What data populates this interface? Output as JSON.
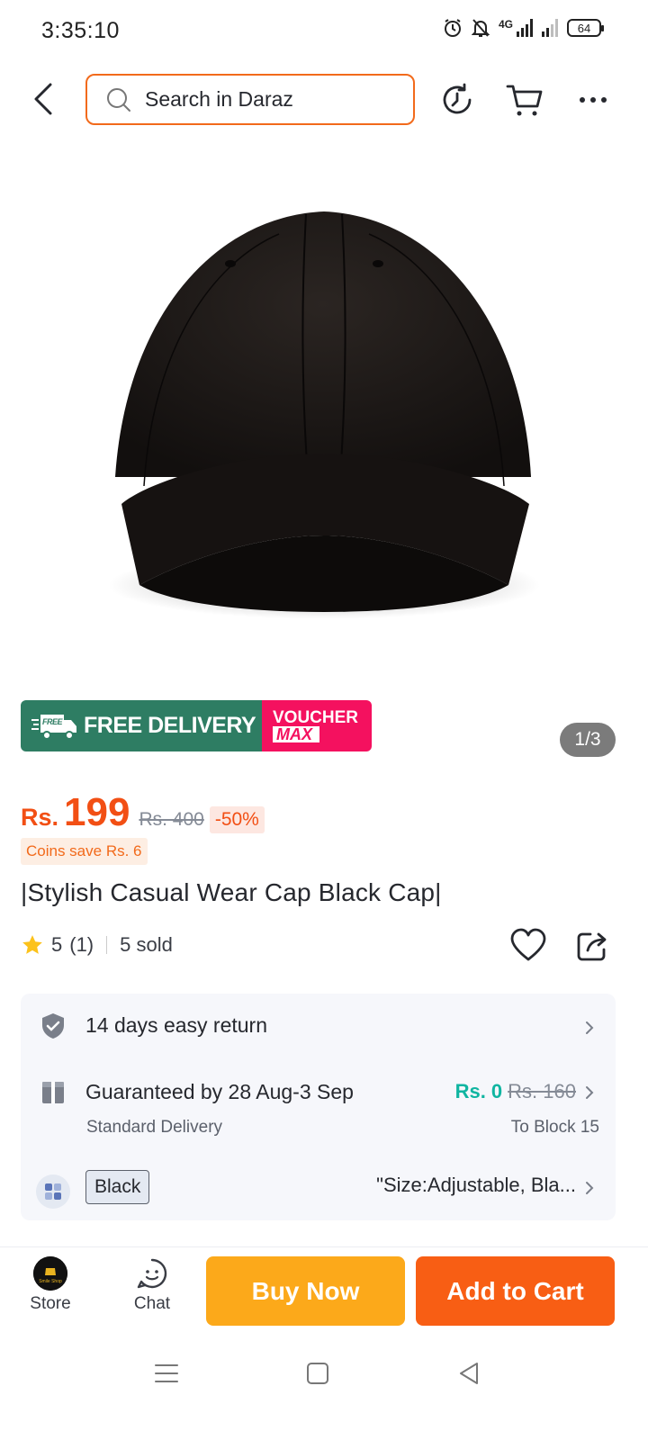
{
  "status_bar": {
    "time": "3:35:10",
    "network": "4G",
    "battery": "64"
  },
  "header": {
    "search_placeholder": "Search in Daraz"
  },
  "gallery": {
    "counter": "1/3",
    "promo_free": "FREE DELIVERY",
    "promo_free_tag": "FREE",
    "promo_voucher_1": "VOUCHER",
    "promo_voucher_2": "MAX"
  },
  "product": {
    "currency": "Rs.",
    "price": "199",
    "original_price": "Rs. 400",
    "discount": "-50%",
    "coins": "Coins save Rs. 6",
    "title": "|Stylish Casual Wear Cap Black Cap|",
    "rating": "5",
    "rating_count": "(1)",
    "sold": "5 sold"
  },
  "info": {
    "return_text": "14 days easy return",
    "delivery_text": "Guaranteed by 28 Aug-3 Sep",
    "delivery_sub": "Standard Delivery",
    "shipping_price": "Rs. 0",
    "shipping_old_price": "Rs. 160",
    "shipping_to": "To Block 15",
    "variant_selected": "Black",
    "variant_detail": "\"Size:Adjustable, Bla..."
  },
  "action_bar": {
    "store_label": "Store",
    "store_logo_text": "Smile Shop",
    "chat_label": "Chat",
    "buy_now": "Buy Now",
    "add_to_cart": "Add to Cart"
  },
  "colors": {
    "brand_orange": "#f85e14",
    "buy_yellow": "#fca91a",
    "free_delivery_green": "#2e7d63",
    "voucher_pink": "#f4115f",
    "shipping_teal": "#10b5a1"
  }
}
